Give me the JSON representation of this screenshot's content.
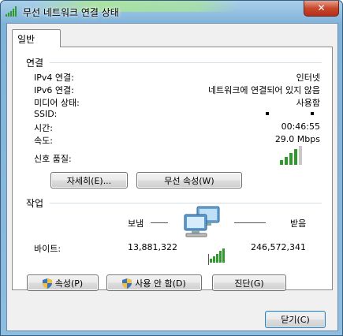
{
  "window": {
    "title": "무선 네트워크 연결 상태",
    "close_glyph": "✕",
    "close_button": "닫기(C)"
  },
  "tab": {
    "label": "일반"
  },
  "connection": {
    "heading": "연결",
    "rows": [
      {
        "label": "IPv4 연결:",
        "value": "인터넷"
      },
      {
        "label": "IPv6 연결:",
        "value": "네트워크에 연결되어 있지 않음"
      },
      {
        "label": "미디어 상태:",
        "value": "사용함"
      },
      {
        "label": "SSID:",
        "value": ""
      },
      {
        "label": "시간:",
        "value": "00:46:55"
      },
      {
        "label": "속도:",
        "value": "29.0 Mbps"
      }
    ],
    "signal_label": "신호 품질:",
    "signal_bars_filled": 4,
    "signal_bars_total": 5,
    "details_button": "자세히(E)...",
    "wireless_props_button": "무선 속성(W)"
  },
  "activity": {
    "heading": "작업",
    "sent_label": "보냄",
    "received_label": "받음",
    "bytes_label": "바이트:",
    "bytes_sent": "13,881,322",
    "bytes_received": "246,572,341"
  },
  "buttons": {
    "properties": "속성(P)",
    "disable": "사용 안 함(D)",
    "diagnose": "진단(G)"
  },
  "colors": {
    "titlebar": "#8dbddf",
    "close": "#c7472b",
    "signal": "#2e9a2a"
  }
}
